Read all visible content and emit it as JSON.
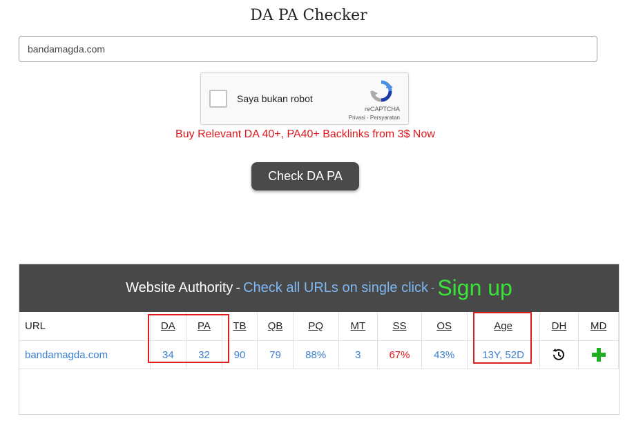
{
  "page": {
    "title": "DA PA Checker"
  },
  "form": {
    "domain_value": "bandamagda.com"
  },
  "captcha": {
    "label": "Saya bukan robot",
    "brand": "reCAPTCHA",
    "links": "Privasi - Persyaratan"
  },
  "promo": {
    "text": "Buy Relevant DA 40+, PA40+ Backlinks from 3$ Now"
  },
  "check_button": {
    "label": "Check DA PA"
  },
  "results": {
    "header": {
      "title": "Website Authority",
      "sep": "-",
      "link": "Check all URLs on single click",
      "dash": "-",
      "signup": "Sign up"
    },
    "columns": [
      "URL",
      "DA",
      "PA",
      "TB",
      "QB",
      "PQ",
      "MT",
      "SS",
      "OS",
      "Age",
      "DH",
      "MD"
    ],
    "row": {
      "url": "bandamagda.com",
      "da": "34",
      "pa": "32",
      "tb": "90",
      "qb": "79",
      "pq": "88%",
      "mt": "3",
      "ss": "67%",
      "os": "43%",
      "age": "13Y, 52D"
    }
  },
  "colors": {
    "accent_link": "#3b7fd0",
    "promo_red": "#e0161b",
    "signup_green": "#39e43a",
    "header_bg": "#484848",
    "button_bg": "#4a4a4a",
    "add_icon": "#22b022"
  },
  "icons": {
    "dh": "history-icon",
    "md": "plus-icon",
    "captcha": "recaptcha-logo-icon"
  }
}
